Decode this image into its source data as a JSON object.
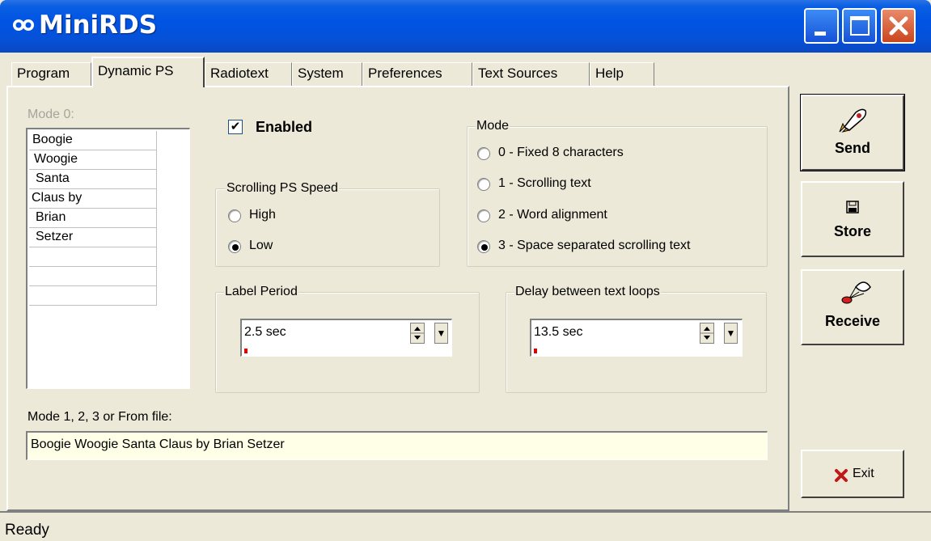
{
  "window": {
    "title": "MiniRDS"
  },
  "tabs": [
    {
      "label": "Program"
    },
    {
      "label": "Dynamic PS"
    },
    {
      "label": "Radiotext"
    },
    {
      "label": "System"
    },
    {
      "label": "Preferences"
    },
    {
      "label": "Text Sources"
    },
    {
      "label": "Help"
    }
  ],
  "active_tab": "Dynamic PS",
  "mode0": {
    "label": "Mode 0:",
    "items": [
      "Boogie",
      "Woogie",
      "Santa",
      "Claus by",
      "Brian",
      "Setzer",
      "",
      "",
      ""
    ]
  },
  "enabled": {
    "label": "Enabled",
    "checked": true,
    "mark": "✔"
  },
  "speed": {
    "title": "Scrolling PS Speed",
    "options": [
      "High",
      "Low"
    ],
    "selected": "Low"
  },
  "mode": {
    "title": "Mode",
    "options": [
      "0 - Fixed 8 characters",
      "1 - Scrolling text",
      "2 - Word alignment",
      "3 - Space separated scrolling text"
    ],
    "selected": "3 - Space separated scrolling text"
  },
  "label_period": {
    "title": "Label Period",
    "value": "2.5 sec"
  },
  "delay_loops": {
    "title": "Delay between text loops",
    "value": "13.5 sec"
  },
  "text_field": {
    "label": "Mode 1, 2, 3 or From file:",
    "value": "Boogie Woogie Santa Claus by Brian Setzer"
  },
  "buttons": {
    "send": "Send",
    "store": "Store",
    "receive": "Receive",
    "exit": "Exit"
  },
  "status": "Ready",
  "colors": {
    "titlebar": "#0054e3",
    "face": "#ece9d8",
    "textbox": "#ffffe8",
    "close": "#c9461d"
  },
  "icons": {
    "app": "infinity-logo-icon",
    "send": "rocket-icon",
    "store": "floppy-disk-icon",
    "receive": "parachute-icon",
    "exit": "red-x-icon"
  }
}
